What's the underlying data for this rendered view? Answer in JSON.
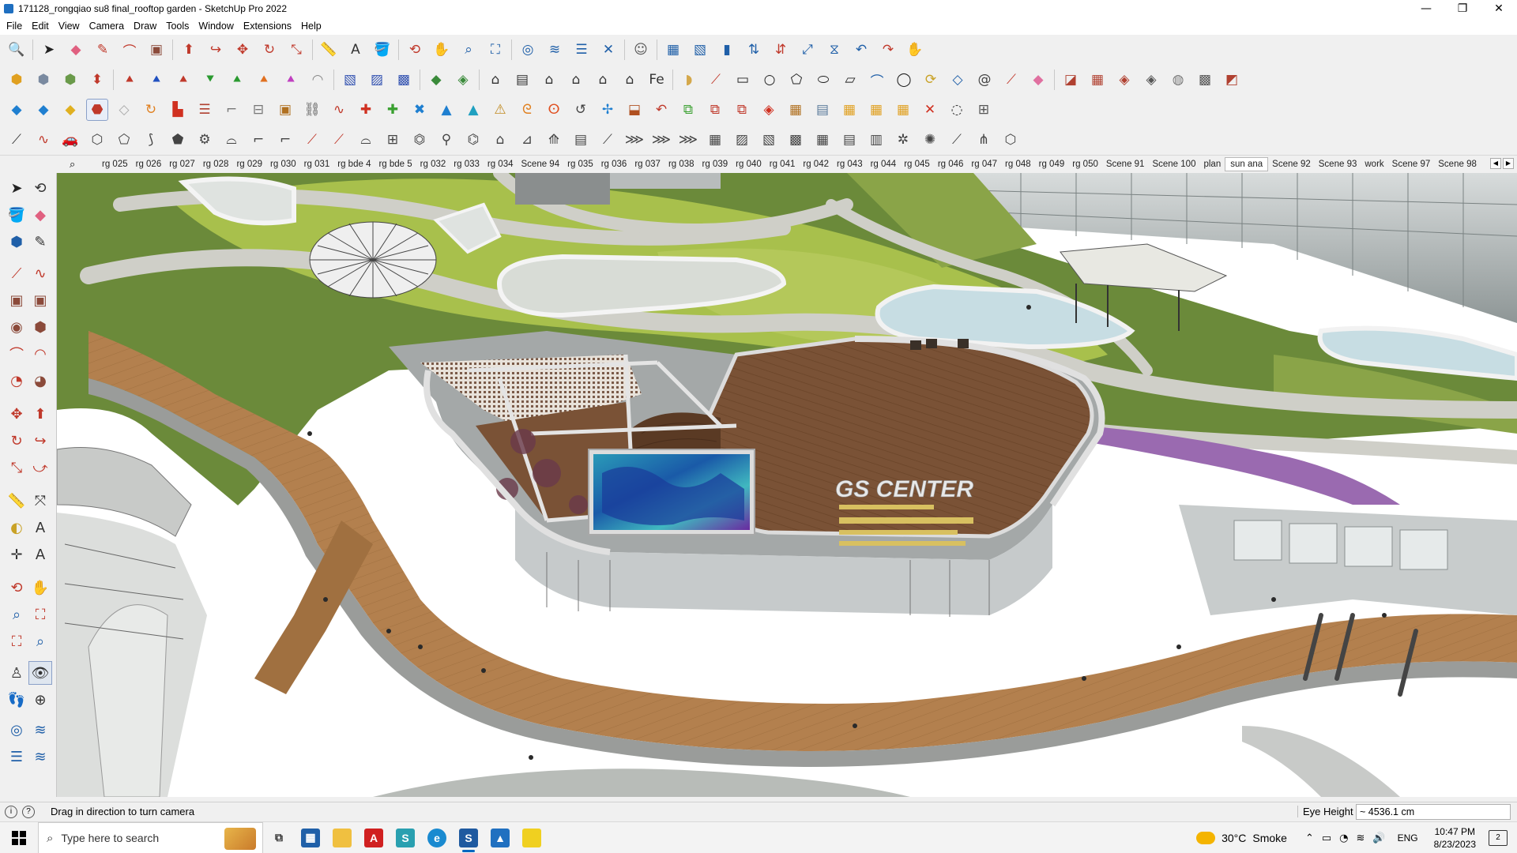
{
  "window": {
    "title": "171128_rongqiao su8 final_rooftop garden - SketchUp Pro 2022",
    "controls": {
      "minimize": "—",
      "maximize": "❐",
      "close": "✕"
    }
  },
  "menu": [
    "File",
    "Edit",
    "View",
    "Camera",
    "Draw",
    "Tools",
    "Window",
    "Extensions",
    "Help"
  ],
  "scene_tabs": [
    "rg 025",
    "rg 026",
    "rg 027",
    "rg 028",
    "rg 029",
    "rg 030",
    "rg 031",
    "rg bde 4",
    "rg bde 5",
    "rg 032",
    "rg 033",
    "rg 034",
    "Scene 94",
    "rg 035",
    "rg 036",
    "rg 037",
    "rg 038",
    "rg 039",
    "rg 040",
    "rg 041",
    "rg 042",
    "rg 043",
    "rg 044",
    "rg 045",
    "rg 046",
    "rg 047",
    "rg 048",
    "rg 049",
    "rg 050",
    "Scene 91",
    "Scene 100",
    "plan",
    "sun ana",
    "Scene 92",
    "Scene 93",
    "work",
    "Scene 97",
    "Scene 98"
  ],
  "active_scene": "sun ana",
  "status": {
    "hint": "Drag in direction to turn camera",
    "measure_label": "Eye Height",
    "measure_value": "~ 4536.1 cm"
  },
  "taskbar": {
    "search_placeholder": "Type here to search",
    "weather_temp": "30°C",
    "weather_desc": "Smoke",
    "language": "ENG",
    "time": "10:47 PM",
    "date": "8/23/2023",
    "notification_count": "2"
  },
  "model": {
    "building_sign": "GS CENTER"
  },
  "colors": {
    "accent": "#0067c0",
    "grass_dark": "#6b8a3a",
    "grass_light": "#a8c04c",
    "deck_wood": "#7a5236",
    "path_wood": "#b3804e",
    "plaza": "#cfcfc8",
    "water": "#c7dde3"
  }
}
